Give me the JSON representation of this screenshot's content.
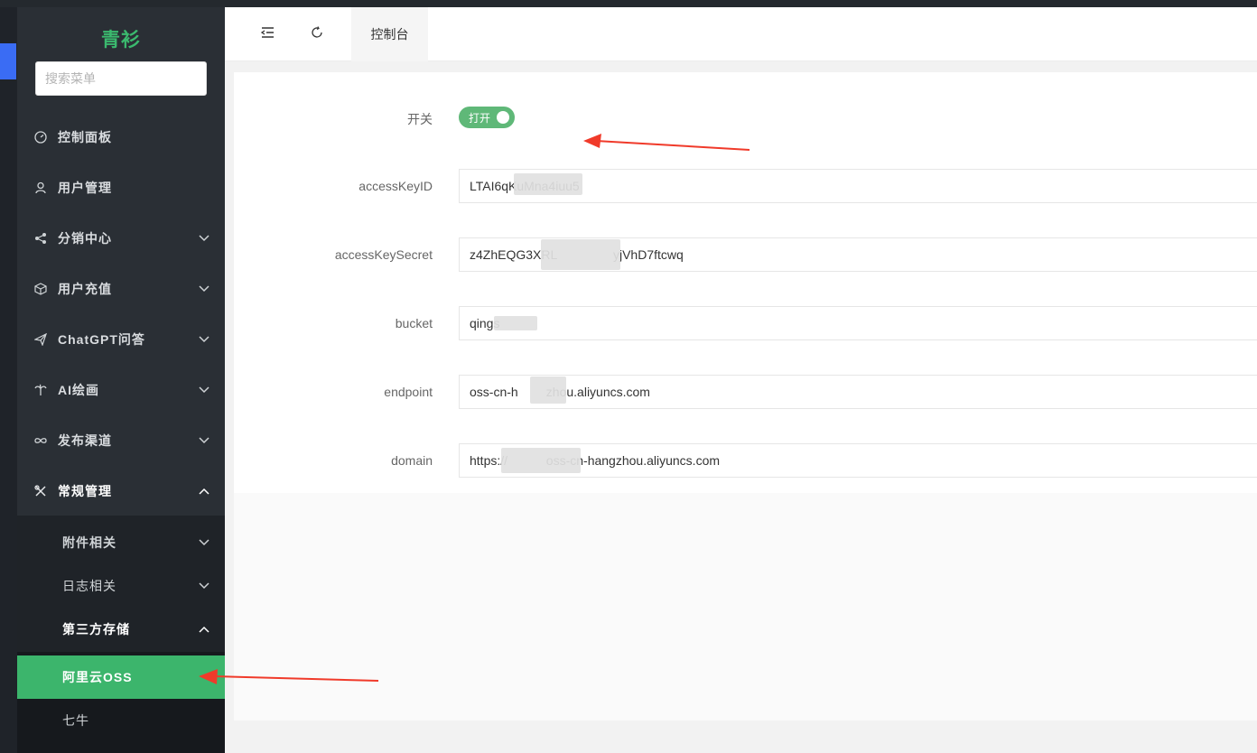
{
  "sidebar": {
    "logo": "青衫",
    "search_placeholder": "搜索菜单",
    "items": [
      {
        "label": "控制面板",
        "icon": "dashboard-icon"
      },
      {
        "label": "用户管理",
        "icon": "user-icon"
      },
      {
        "label": "分销中心",
        "icon": "share-icon"
      },
      {
        "label": "用户充值",
        "icon": "box-icon"
      },
      {
        "label": "ChatGPT问答",
        "icon": "paper-plane-icon"
      },
      {
        "label": "AI绘画",
        "icon": "palm-icon"
      },
      {
        "label": "发布渠道",
        "icon": "infinity-icon"
      },
      {
        "label": "常规管理",
        "icon": "tools-icon"
      }
    ],
    "submenu": {
      "attachments": "附件相关",
      "logs": "日志相关",
      "third_party": "第三方存储",
      "aliyun": "阿里云OSS",
      "qiniu": "七牛"
    }
  },
  "header": {
    "tab": "控制台"
  },
  "form": {
    "switch_label": "开关",
    "switch_text": "打开",
    "fields": [
      {
        "label": "accessKeyID",
        "value": "LTAI6qKuMna4iuu5"
      },
      {
        "label": "accessKeySecret",
        "value": "z4ZhEQG3XRL                yjVhD7ftcwq"
      },
      {
        "label": "bucket",
        "value": "qings"
      },
      {
        "label": "endpoint",
        "value": "oss-cn-h        zhou.aliyuncs.com"
      },
      {
        "label": "domain",
        "value": "https://           oss-cn-hangzhou.aliyuncs.com"
      }
    ]
  },
  "colors": {
    "sidebar_bg": "#2a2f35",
    "accent_green": "#3cb56c",
    "logo_green": "#3bb96e",
    "switch_green": "#5fb878",
    "arrow_red": "#f03a2a"
  }
}
